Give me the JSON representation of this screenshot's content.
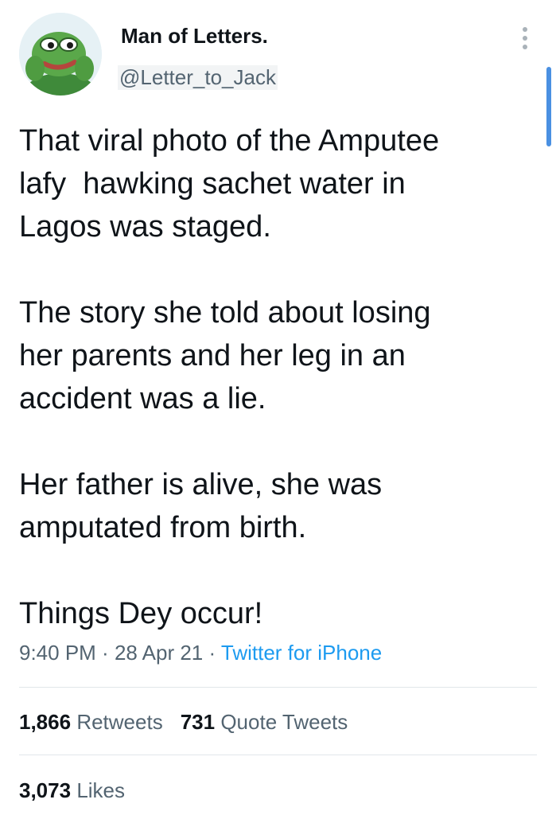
{
  "author": {
    "display_name": "Man of Letters.",
    "handle": "@Letter_to_Jack",
    "avatar_icon": "frog-avatar-icon"
  },
  "tweet": {
    "lines": [
      "That viral photo of the Amputee",
      "lafy  hawking sachet water in",
      "Lagos was staged.",
      "",
      "The story she told about losing",
      "her parents and her leg in an",
      "accident was a lie.",
      "",
      "Her father is alive, she was",
      "amputated from birth.",
      "",
      "Things Dey occur!"
    ]
  },
  "meta": {
    "time": "9:40 PM",
    "date": "28 Apr 21",
    "separator": " · ",
    "source": "Twitter for iPhone"
  },
  "stats": {
    "retweets_count": "1,866",
    "retweets_label": "Retweets",
    "quotes_count": "731",
    "quotes_label": "Quote Tweets",
    "likes_count": "3,073",
    "likes_label": "Likes"
  },
  "colors": {
    "link": "#1d9bf0",
    "secondary_text": "#536471",
    "scrollbar": "#4a90e2"
  }
}
